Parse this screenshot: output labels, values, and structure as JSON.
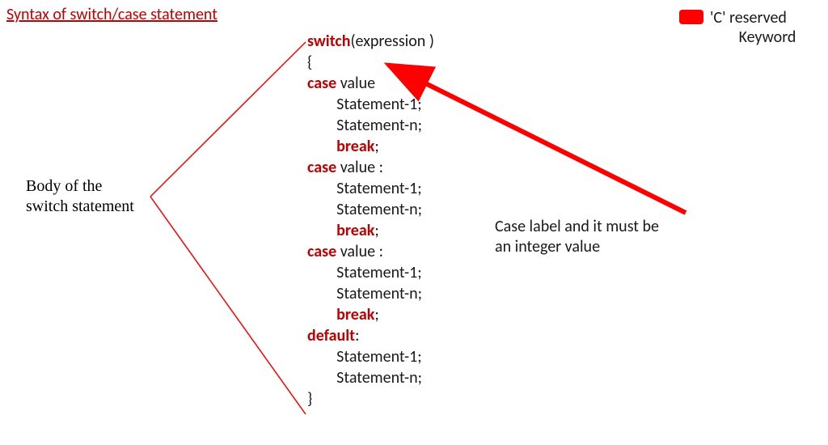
{
  "title": "Syntax of switch/case statement",
  "side_label": {
    "l1": "Body of the",
    "l2": "switch statement"
  },
  "callout": {
    "l1": "Case label and it must be",
    "l2": "an integer value"
  },
  "legend": {
    "l1": "'C' reserved",
    "l2": "Keyword"
  },
  "code": {
    "switch_kw": "switch",
    "expr_open": "(",
    "expr": "expression ",
    "expr_close": ")",
    "lbrace": "{",
    "rbrace": "}",
    "case_kw": "case",
    "default_kw": "default",
    "break_kw": "break",
    "value_txt": " value",
    "colon": ":",
    "colon_sp": " :",
    "semi": ";",
    "stmt1": "Statement-1;",
    "stmtn": "Statement-n;",
    "indent_case": "",
    "indent_stmt": "        "
  },
  "colors": {
    "accent": "#c00000",
    "arrow": "#ff0000"
  }
}
